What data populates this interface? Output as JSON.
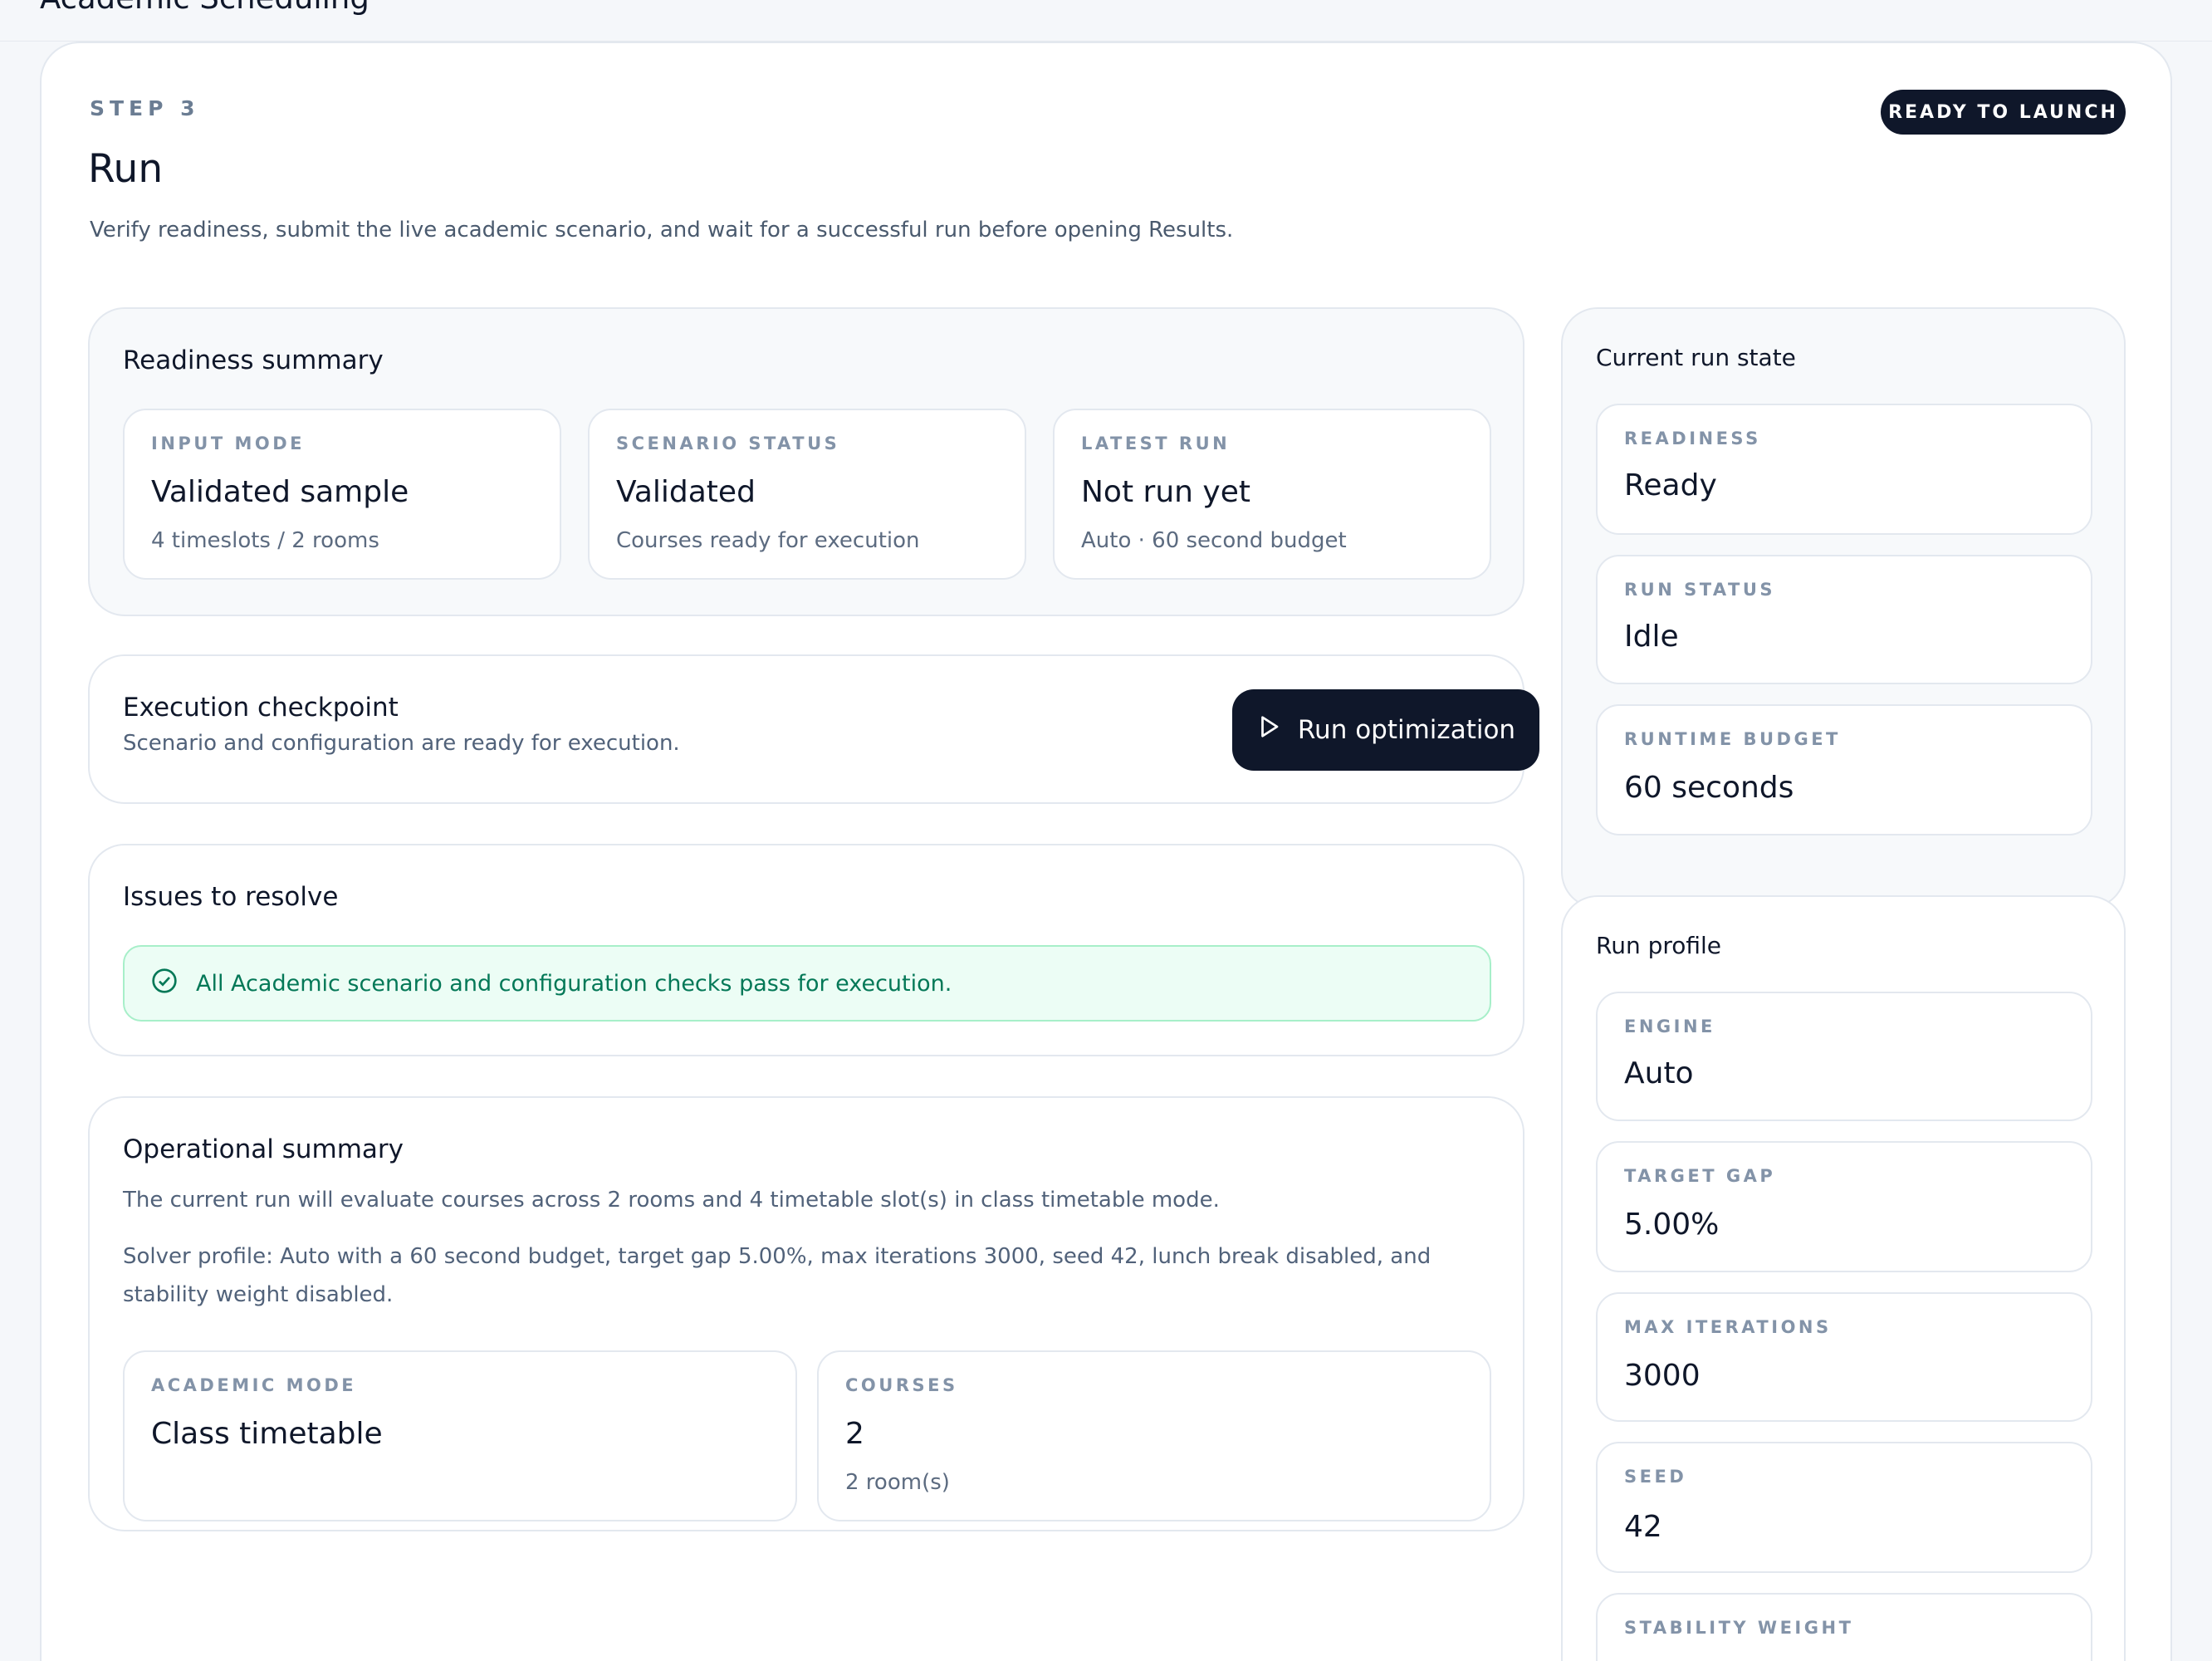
{
  "app": {
    "title": "Academic Scheduling"
  },
  "header": {
    "step_label": "STEP 3",
    "badge": "READY TO LAUNCH",
    "title": "Run",
    "subtitle": "Verify readiness, submit the live academic scenario, and wait for a successful run before opening Results."
  },
  "readiness_summary": {
    "title": "Readiness summary",
    "cards": [
      {
        "label": "INPUT MODE",
        "value": "Validated sample",
        "sub": "4 timeslots / 2 rooms"
      },
      {
        "label": "SCENARIO STATUS",
        "value": "Validated",
        "sub": "Courses ready for execution"
      },
      {
        "label": "LATEST RUN",
        "value": "Not run yet",
        "sub": "Auto · 60 second budget"
      }
    ]
  },
  "execution_checkpoint": {
    "title": "Execution checkpoint",
    "text": "Scenario and configuration are ready for execution.",
    "button_label": "Run optimization",
    "button_icon": "play-icon"
  },
  "issues": {
    "title": "Issues to resolve",
    "message": "All Academic scenario and configuration checks pass for execution.",
    "icon": "check-circle-icon"
  },
  "operational_summary": {
    "title": "Operational summary",
    "line1": "The current run will evaluate courses across 2 rooms and 4 timetable slot(s) in class timetable mode.",
    "line2": "Solver profile: Auto with a 60 second budget, target gap 5.00%, max iterations 3000, seed 42, lunch break disabled, and stability weight disabled.",
    "cards": [
      {
        "label": "ACADEMIC MODE",
        "value": "Class timetable",
        "sub": ""
      },
      {
        "label": "COURSES",
        "value": "2",
        "sub": "2 room(s)"
      }
    ]
  },
  "current_run_state": {
    "title": "Current run state",
    "cards": [
      {
        "label": "READINESS",
        "value": "Ready"
      },
      {
        "label": "RUN STATUS",
        "value": "Idle"
      },
      {
        "label": "RUNTIME BUDGET",
        "value": "60 seconds"
      }
    ]
  },
  "run_profile": {
    "title": "Run profile",
    "cards": [
      {
        "label": "ENGINE",
        "value": "Auto"
      },
      {
        "label": "TARGET GAP",
        "value": "5.00%"
      },
      {
        "label": "MAX ITERATIONS",
        "value": "3000"
      },
      {
        "label": "SEED",
        "value": "42"
      },
      {
        "label": "STABILITY WEIGHT",
        "value": ""
      }
    ]
  },
  "colors": {
    "primary_dark": "#0f172a",
    "success_bg": "#ecfdf5",
    "success_text": "#047857",
    "muted_text": "#51627a"
  }
}
